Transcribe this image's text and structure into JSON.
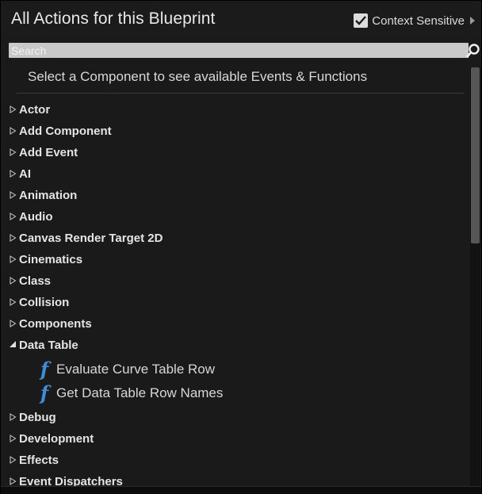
{
  "header": {
    "title": "All Actions for this Blueprint",
    "context_sensitive_label": "Context Sensitive",
    "context_sensitive_checked": true
  },
  "search": {
    "placeholder": "Search",
    "value": ""
  },
  "hint": "Select a Component to see available Events & Functions",
  "categories": [
    {
      "label": "Actor",
      "expanded": false
    },
    {
      "label": "Add Component",
      "expanded": false
    },
    {
      "label": "Add Event",
      "expanded": false
    },
    {
      "label": "AI",
      "expanded": false
    },
    {
      "label": "Animation",
      "expanded": false
    },
    {
      "label": "Audio",
      "expanded": false
    },
    {
      "label": "Canvas Render Target 2D",
      "expanded": false
    },
    {
      "label": "Cinematics",
      "expanded": false
    },
    {
      "label": "Class",
      "expanded": false
    },
    {
      "label": "Collision",
      "expanded": false
    },
    {
      "label": "Components",
      "expanded": false
    },
    {
      "label": "Data Table",
      "expanded": true,
      "items": [
        "Evaluate Curve Table Row",
        "Get Data Table Row Names"
      ]
    },
    {
      "label": "Debug",
      "expanded": false
    },
    {
      "label": "Development",
      "expanded": false
    },
    {
      "label": "Effects",
      "expanded": false
    },
    {
      "label": "Event Dispatchers",
      "expanded": false
    }
  ],
  "icons": {
    "function": "function-icon",
    "collapsed": "triangle-right-icon",
    "expanded": "triangle-down-icon"
  },
  "colors": {
    "function_icon": "#3d8dd8",
    "background": "#1a1a1a",
    "checkbox": "#dcdcdc"
  }
}
